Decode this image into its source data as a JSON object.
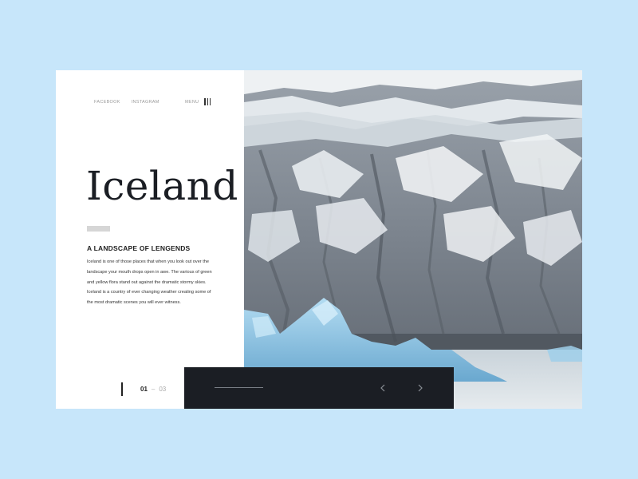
{
  "header": {
    "social_links": [
      {
        "label": "FACEBOOK"
      },
      {
        "label": "INSTAGRAM"
      }
    ],
    "menu_label": "MENU"
  },
  "hero": {
    "title": "Iceland",
    "subtitle": "A LANDSCAPE OF LENGENDS",
    "body": "Iceland is one of those places that when you look out over the landscape your mouth drops open in awe. The various of green and yellow flora stand out against the dramatic stormy skies. Iceland is a country of ever changing weather creating some of the most dramatic scenes you will ever witness."
  },
  "pager": {
    "current": "01",
    "separator": "–",
    "total": "03"
  },
  "nav": {
    "prev_icon": "chevron-left-icon",
    "next_icon": "chevron-right-icon"
  },
  "colors": {
    "background": "#c7e6fa",
    "dark": "#1b1e24",
    "ice": "#8fc3e3"
  }
}
